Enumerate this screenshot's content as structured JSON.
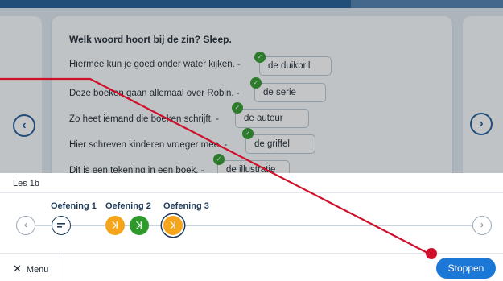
{
  "exercise": {
    "prompt": "Welk woord hoort bij de zin? Sleep.",
    "items": [
      {
        "sentence": "Hiermee kun je goed onder water kijken. -",
        "answer": "de duikbril",
        "check": "✓"
      },
      {
        "sentence": "Deze boeken gaan allemaal over Robin. -",
        "answer": "de serie",
        "check": "✓"
      },
      {
        "sentence": "Zo heet iemand die boeken schrijft. -",
        "answer": "de auteur",
        "check": "✓"
      },
      {
        "sentence": "Hier schreven kinderen vroeger mee. -",
        "answer": "de griffel",
        "check": "✓"
      },
      {
        "sentence": "Dit is een tekening in een boek. -",
        "answer": "de illustratie",
        "check": "✓"
      }
    ],
    "prev_arrow": "‹",
    "next_arrow": "›"
  },
  "panel": {
    "lesson_label": "Les 1b",
    "steps": [
      {
        "label": "Oefening 1",
        "icon": "lines-icon",
        "color": "#ffffff"
      },
      {
        "label": "Oefening 2",
        "icon": "runner-icon",
        "color": "#f5a51c"
      },
      {
        "label": "",
        "icon": "runner-icon",
        "color": "#2f9a2b"
      },
      {
        "label": "Oefening 3",
        "icon": "runner-icon",
        "color": "#f5a51c"
      }
    ],
    "step_glyph": "ꓘ",
    "prev_arrow": "‹",
    "next_arrow": "›",
    "menu_icon": "✕",
    "menu_label": "Menu",
    "stop_label": "Stoppen"
  },
  "colors": {
    "primary": "#1e5b95",
    "accent_orange": "#f5a51c",
    "accent_green": "#2f9a2b",
    "button_blue": "#1c78d6",
    "annotation_red": "#d0102b"
  }
}
